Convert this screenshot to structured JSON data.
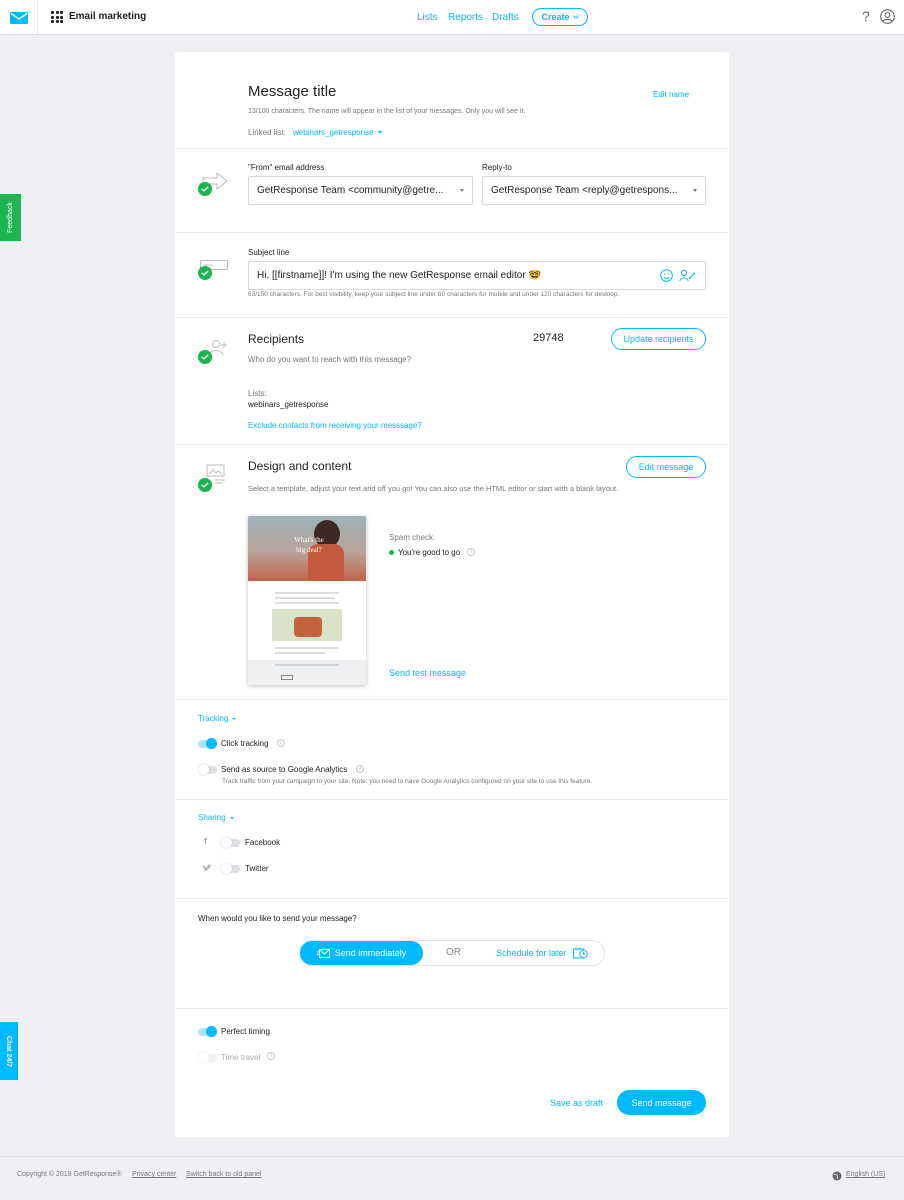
{
  "app": {
    "name": "Email marketing"
  },
  "nav": {
    "lists": "Lists",
    "reports": "Reports",
    "drafts": "Drafts",
    "create": "Create"
  },
  "side": {
    "feedback": "Feedback",
    "chat": "Chat 24/7"
  },
  "message": {
    "title": "Message title",
    "edit_name": "Edit name",
    "hint": "13/100 characters. The name will appear in the list of your messages. Only you will see it.",
    "linked_list_label": "Linked list:",
    "linked_list_value": "webinars_getresponse"
  },
  "from": {
    "label": "\"From\" email address",
    "value": "GetResponse Team <community@getre...",
    "reply_label": "Reply-to",
    "reply_value": "GetResponse Team <reply@getrespons..."
  },
  "subject": {
    "label": "Subject line",
    "value": "Hi, [[firstname]]! I'm using the new GetResponse email editor 🤓",
    "hint": "63/150 characters. For best visibility, keep your subject line under 60 characters for mobile and under 120 characters for desktop."
  },
  "recipients": {
    "title": "Recipients",
    "count": "29748",
    "update_button": "Update recipients",
    "question": "Who do you want to reach with this message?",
    "lists_label": "Lists:",
    "lists_value": "webinars_getresponse",
    "exclude_link": "Exclude contacts from receiving your messsage?"
  },
  "design": {
    "title": "Design and content",
    "edit_button": "Edit message",
    "description": "Select a template, adjust your text and off you go! You can also use the HTML editor or start with a blank layout.",
    "preview_headline": "What's the big deal?",
    "spam_label": "Spam check",
    "spam_status": "You're good to go",
    "send_test": "Send test message"
  },
  "tracking": {
    "title": "Tracking",
    "click_label": "Click tracking",
    "ga_label": "Send as source to Google Analytics",
    "ga_hint": "Track traffic from your campaign to your site. Note: you need to have Google Analytics configured on your site to use this feature.",
    "click_on": true,
    "ga_on": false
  },
  "sharing": {
    "title": "Sharing",
    "facebook": "Facebook",
    "twitter": "Twitter"
  },
  "schedule": {
    "question": "When would you like to send your message?",
    "send_now": "Send immediately",
    "or": "OR",
    "later": "Schedule for later"
  },
  "options": {
    "perfect_timing": "Perfect timing",
    "time_travel": "Time travel"
  },
  "actions": {
    "save_draft": "Save as draft",
    "send": "Send message"
  },
  "footer": {
    "copyright": "Copyright © 2019 GetResponse®",
    "privacy": "Privacy center",
    "switch": "Switch back to old panel",
    "language": "English (US)"
  },
  "colors": {
    "accent": "#00baff",
    "success": "#1db54f"
  }
}
